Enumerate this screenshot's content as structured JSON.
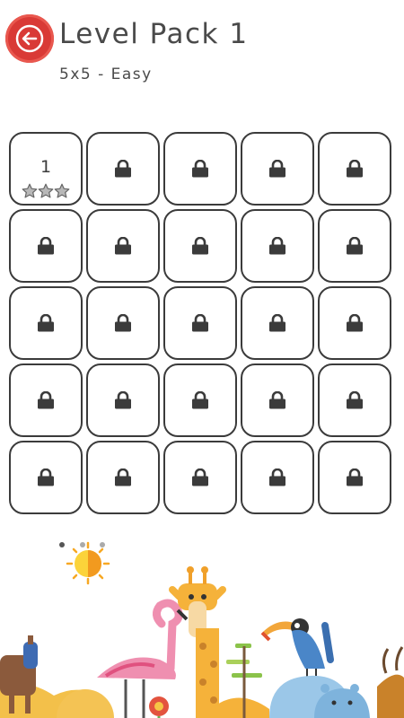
{
  "header": {
    "back_icon": "arrow-left-icon",
    "title": "Level Pack  1",
    "subtitle": "5x5 - Easy"
  },
  "levels": [
    {
      "number": "1",
      "locked": false,
      "stars_earned": 0,
      "stars_total": 3
    },
    {
      "locked": true
    },
    {
      "locked": true
    },
    {
      "locked": true
    },
    {
      "locked": true
    },
    {
      "locked": true
    },
    {
      "locked": true
    },
    {
      "locked": true
    },
    {
      "locked": true
    },
    {
      "locked": true
    },
    {
      "locked": true
    },
    {
      "locked": true
    },
    {
      "locked": true
    },
    {
      "locked": true
    },
    {
      "locked": true
    },
    {
      "locked": true
    },
    {
      "locked": true
    },
    {
      "locked": true
    },
    {
      "locked": true
    },
    {
      "locked": true
    },
    {
      "locked": true
    },
    {
      "locked": true
    },
    {
      "locked": true
    },
    {
      "locked": true
    },
    {
      "locked": true
    }
  ],
  "icons": {
    "lock": "lock-icon",
    "star": "star-icon"
  },
  "colors": {
    "accent_red": "#d93a36",
    "tile_border": "#3b3b3b",
    "star_empty": "#b8b8b8",
    "sun": "#f7a823"
  }
}
